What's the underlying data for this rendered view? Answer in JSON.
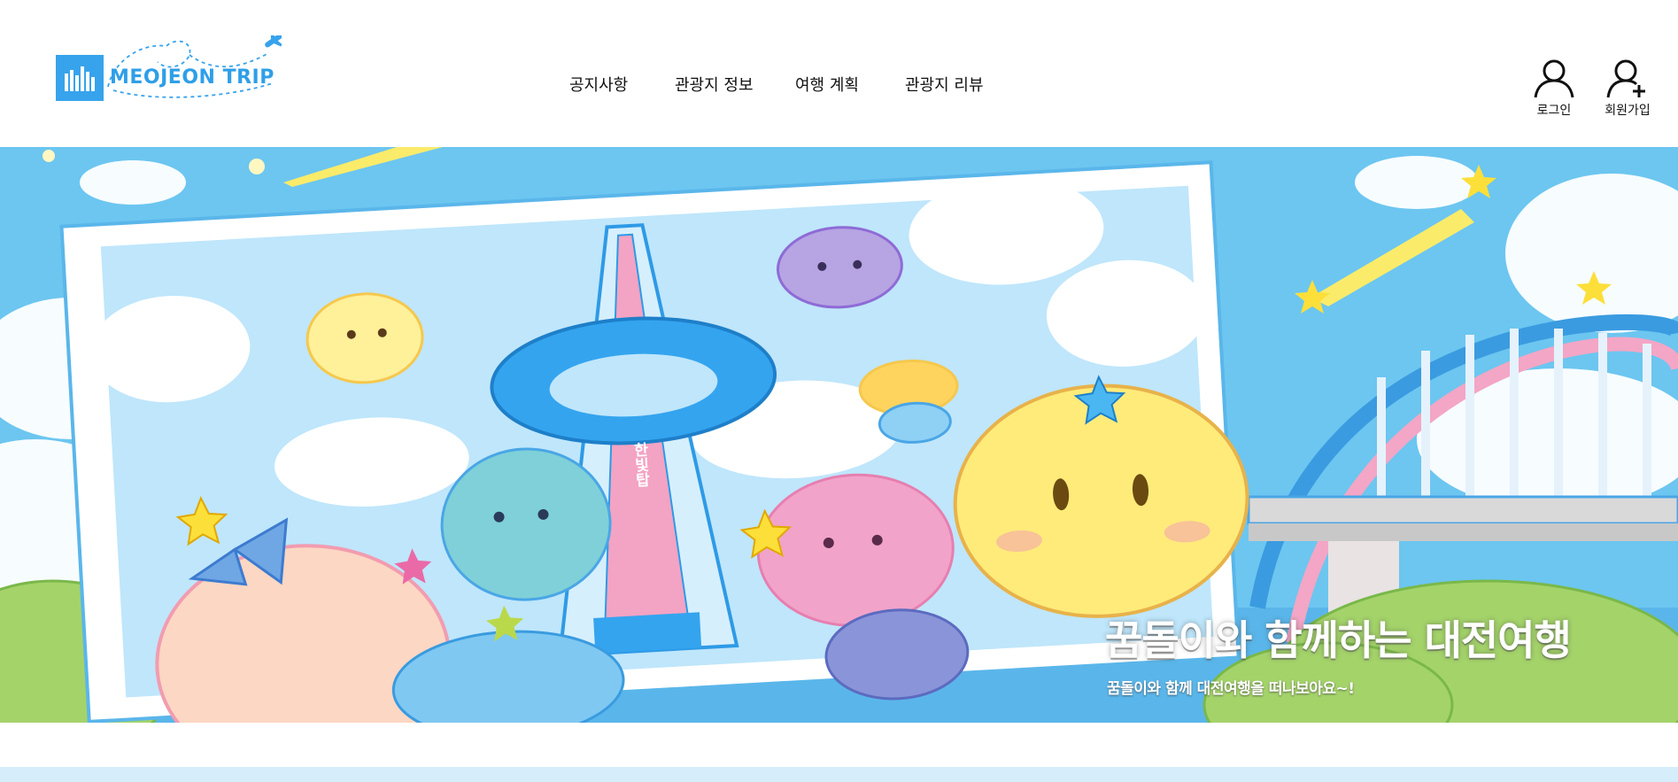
{
  "brand": {
    "logo_text": "MEOJEON TRIP",
    "primary_color": "#37a3ec"
  },
  "nav": {
    "items": [
      {
        "label": "공지사항"
      },
      {
        "label": "관광지 정보"
      },
      {
        "label": "여행 계획"
      },
      {
        "label": "관광지 리뷰"
      }
    ]
  },
  "user_actions": {
    "login_label": "로그인",
    "signup_label": "회원가입",
    "login_icon": "user-icon",
    "signup_icon": "user-plus-icon"
  },
  "hero": {
    "title": "꿈돌이와 함께하는 대전여행",
    "subtitle": "꿈돌이와 함께 대전여행을 떠나보아요~!",
    "tower_sign": "한빛탑",
    "sky_color": "#67c4ef",
    "frame_color": "#ffffff"
  },
  "section_strip_color": "#d6eefb"
}
